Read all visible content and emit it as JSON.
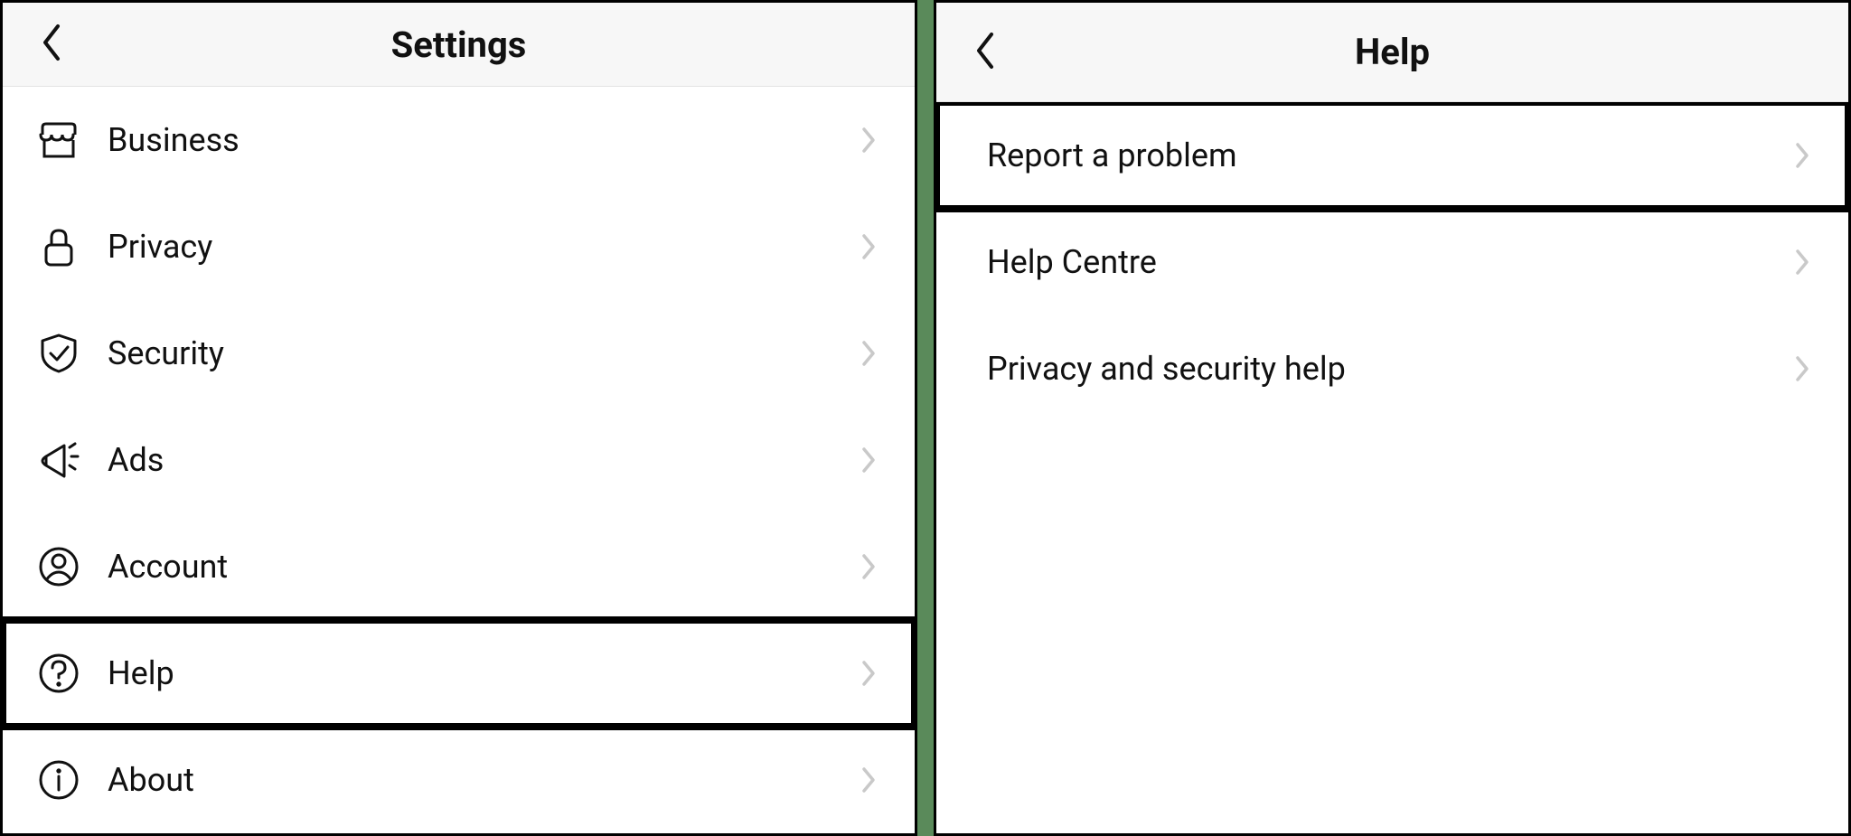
{
  "left": {
    "title": "Settings",
    "items": [
      {
        "icon": "business-icon",
        "label": "Business",
        "highlight": false
      },
      {
        "icon": "privacy-icon",
        "label": "Privacy",
        "highlight": false
      },
      {
        "icon": "security-icon",
        "label": "Security",
        "highlight": false
      },
      {
        "icon": "ads-icon",
        "label": "Ads",
        "highlight": false
      },
      {
        "icon": "account-icon",
        "label": "Account",
        "highlight": false
      },
      {
        "icon": "help-icon",
        "label": "Help",
        "highlight": true
      },
      {
        "icon": "about-icon",
        "label": "About",
        "highlight": false
      }
    ]
  },
  "right": {
    "title": "Help",
    "items": [
      {
        "label": "Report a problem",
        "highlight": true
      },
      {
        "label": "Help Centre",
        "highlight": false
      },
      {
        "label": "Privacy and security help",
        "highlight": false
      }
    ]
  }
}
